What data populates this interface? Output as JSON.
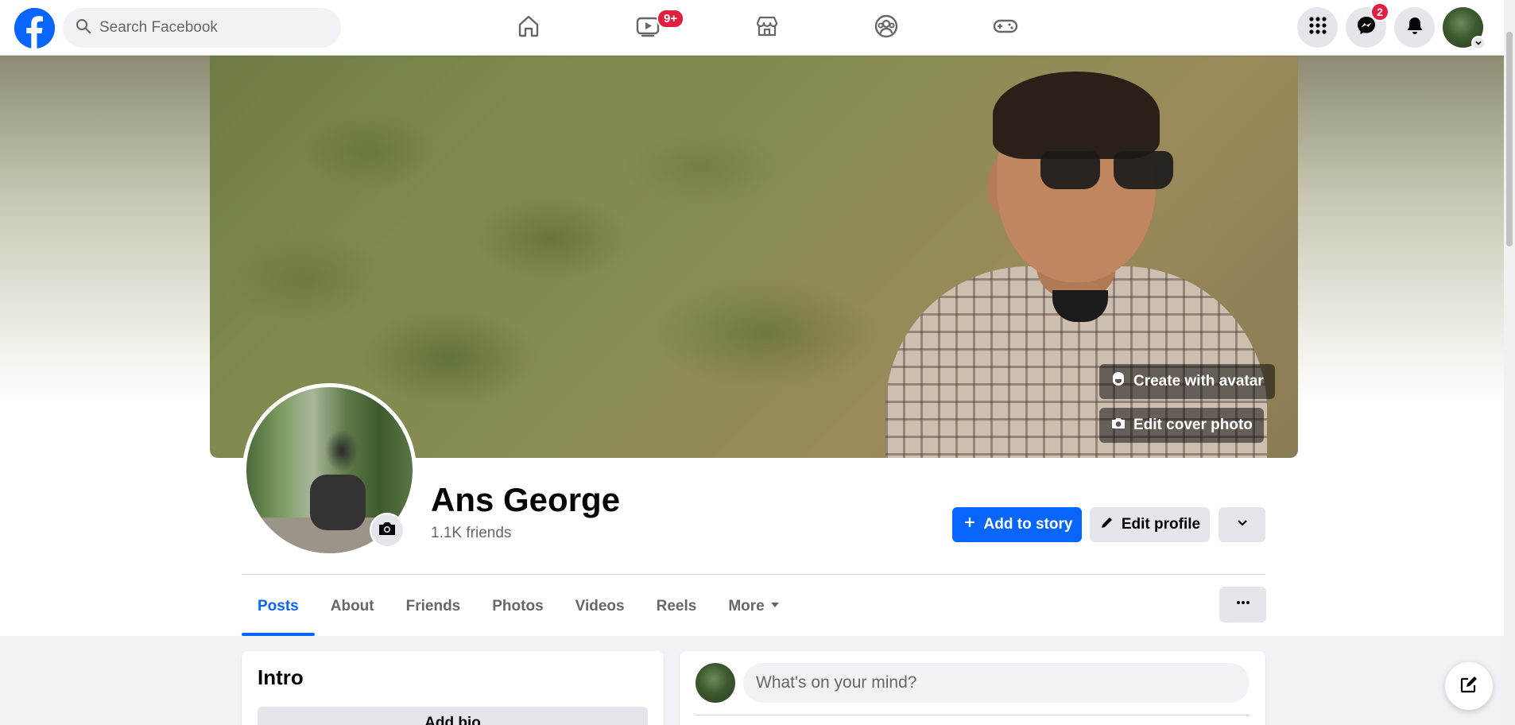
{
  "topbar": {
    "search_placeholder": "Search Facebook",
    "watch_badge": "9+",
    "messenger_badge": "2"
  },
  "cover": {
    "create_avatar_label": "Create with avatar",
    "edit_cover_label": "Edit cover photo"
  },
  "profile": {
    "name": "Ans George",
    "friends": "1.1K friends"
  },
  "actions": {
    "add_story_label": "Add to story",
    "edit_profile_label": "Edit profile"
  },
  "tabs": [
    {
      "label": "Posts"
    },
    {
      "label": "About"
    },
    {
      "label": "Friends"
    },
    {
      "label": "Photos"
    },
    {
      "label": "Videos"
    },
    {
      "label": "Reels"
    },
    {
      "label": "More"
    }
  ],
  "intro": {
    "title": "Intro",
    "add_bio_label": "Add bio"
  },
  "composer": {
    "placeholder": "What's on your mind?"
  },
  "colors": {
    "brand": "#0866ff",
    "badge": "#e41e3f"
  }
}
